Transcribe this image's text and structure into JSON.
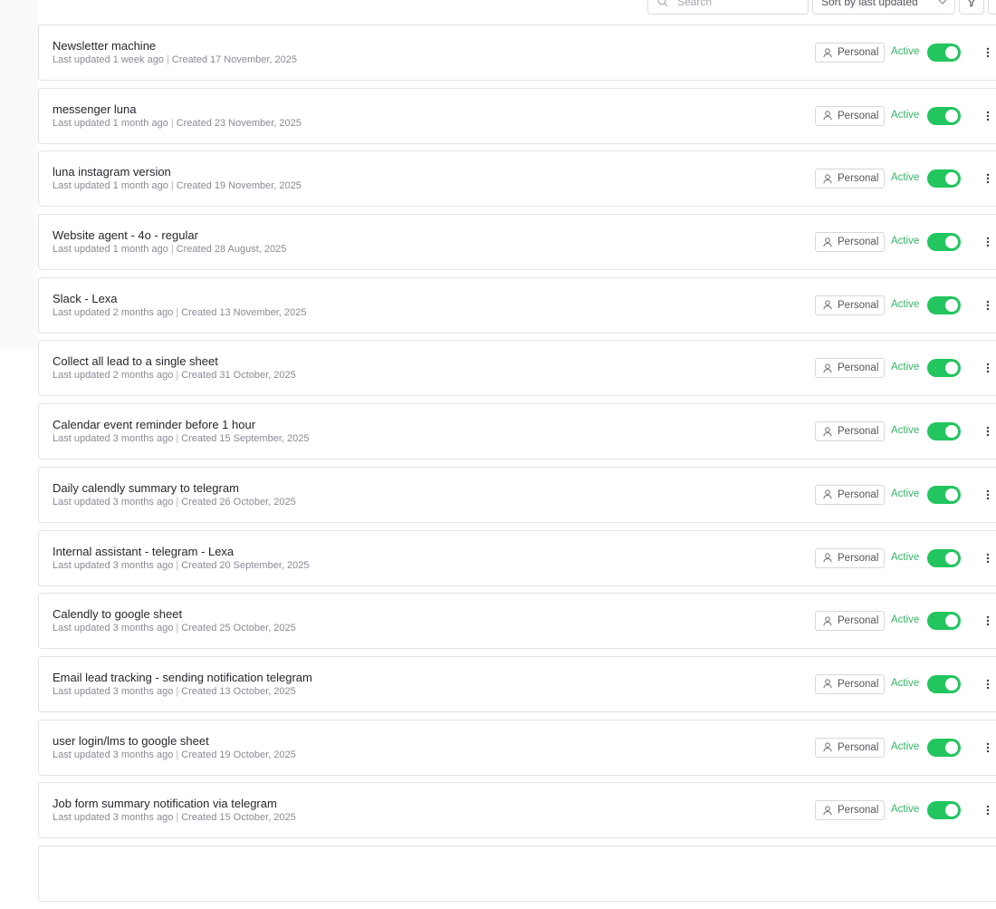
{
  "toolbar": {
    "search_placeholder": "Search",
    "sort_value": "Sort by last updated"
  },
  "status_color": "#22c55e",
  "workflows": [
    {
      "title": "Newsletter machine",
      "updated": "Last updated 1 week ago",
      "created": "Created 17 November, 2025",
      "badge": "Personal",
      "status": "Active"
    },
    {
      "title": "messenger luna",
      "updated": "Last updated 1 month ago",
      "created": "Created 23 November, 2025",
      "badge": "Personal",
      "status": "Active"
    },
    {
      "title": "luna instagram version",
      "updated": "Last updated 1 month ago",
      "created": "Created 19 November, 2025",
      "badge": "Personal",
      "status": "Active"
    },
    {
      "title": "Website agent - 4o - regular",
      "updated": "Last updated 1 month ago",
      "created": "Created 28 August, 2025",
      "badge": "Personal",
      "status": "Active"
    },
    {
      "title": "Slack - Lexa",
      "updated": "Last updated 2 months ago",
      "created": "Created 13 November, 2025",
      "badge": "Personal",
      "status": "Active"
    },
    {
      "title": "Collect all lead to a single sheet",
      "updated": "Last updated 2 months ago",
      "created": "Created 31 October, 2025",
      "badge": "Personal",
      "status": "Active"
    },
    {
      "title": "Calendar event reminder before 1 hour",
      "updated": "Last updated 3 months ago",
      "created": "Created 15 September, 2025",
      "badge": "Personal",
      "status": "Active"
    },
    {
      "title": "Daily calendly summary to telegram",
      "updated": "Last updated 3 months ago",
      "created": "Created 26 October, 2025",
      "badge": "Personal",
      "status": "Active"
    },
    {
      "title": "Internal assistant - telegram - Lexa",
      "updated": "Last updated 3 months ago",
      "created": "Created 20 September, 2025",
      "badge": "Personal",
      "status": "Active"
    },
    {
      "title": "Calendly to google sheet",
      "updated": "Last updated 3 months ago",
      "created": "Created 25 October, 2025",
      "badge": "Personal",
      "status": "Active"
    },
    {
      "title": "Email lead tracking - sending notification telegram",
      "updated": "Last updated 3 months ago",
      "created": "Created 13 October, 2025",
      "badge": "Personal",
      "status": "Active"
    },
    {
      "title": "user login/lms to google sheet",
      "updated": "Last updated 3 months ago",
      "created": "Created 19 October, 2025",
      "badge": "Personal",
      "status": "Active"
    },
    {
      "title": "Job form summary notification via telegram",
      "updated": "Last updated 3 months ago",
      "created": "Created 15 October, 2025",
      "badge": "Personal",
      "status": "Active"
    }
  ]
}
